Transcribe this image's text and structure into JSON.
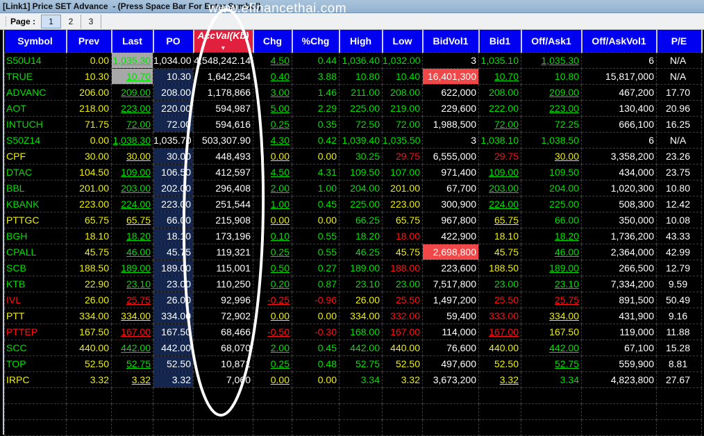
{
  "window": {
    "title": "[Link1] Price SET Advance  - (Press Space Bar For Enter Symbol)"
  },
  "watermark": "www.efinancethai.com",
  "toolbar": {
    "page_label": "Page :",
    "pages": [
      "1",
      "2",
      "3"
    ],
    "active_page": "1"
  },
  "colors": {
    "g": "#00e000",
    "y": "#f0f000",
    "r": "#ff1010",
    "w": "#ffffff",
    "header": "#0000f0",
    "sorted_header": "#e0203c"
  },
  "headers": [
    "Symbol",
    "Prev",
    "Last",
    "PO",
    "AccVal(Kb)",
    "Chg",
    "%Chg",
    "High",
    "Low",
    "BidVol1",
    "Bid1",
    "Off/Ask1",
    "Off/AskVol1",
    "P/E"
  ],
  "sorted_column": "AccVal(Kb)",
  "rows": [
    {
      "cells": [
        "S50U14",
        "0.00",
        "1,035.30",
        "1,034.00",
        "4,548,242.14",
        "4.50",
        "0.44",
        "1,036.40",
        "1,032.00",
        "3",
        "1,035.10",
        "1,035.30",
        "6",
        "N/A"
      ],
      "colors": [
        "g",
        "y",
        "g_",
        "w",
        "w",
        "g_",
        "g",
        "g",
        "g",
        "w",
        "g",
        "g_",
        "w",
        "w"
      ],
      "bg": {
        "2": "grey"
      }
    },
    {
      "cells": [
        "TRUE",
        "10.30",
        "10.70",
        "10.30",
        "1,642,254",
        "0.40",
        "3.88",
        "10.80",
        "10.40",
        "16,401,300",
        "10.70",
        "10.80",
        "15,817,000",
        "N/A"
      ],
      "colors": [
        "g",
        "y",
        "g_",
        "w",
        "w",
        "g_",
        "g",
        "g",
        "g",
        "w",
        "g_",
        "g",
        "w",
        "w"
      ],
      "bg": {
        "2": "grey",
        "3": "blue",
        "9": "red"
      }
    },
    {
      "cells": [
        "ADVANC",
        "206.00",
        "209.00",
        "208.00",
        "1,178,866",
        "3.00",
        "1.46",
        "211.00",
        "208.00",
        "622,000",
        "208.00",
        "209.00",
        "467,200",
        "17.70"
      ],
      "colors": [
        "g",
        "y",
        "g_",
        "w",
        "w",
        "g_",
        "g",
        "g",
        "g",
        "w",
        "g",
        "g_",
        "w",
        "w"
      ],
      "bg": {
        "3": "blue"
      }
    },
    {
      "cells": [
        "AOT",
        "218.00",
        "223.00",
        "220.00",
        "594,987",
        "5.00",
        "2.29",
        "225.00",
        "219.00",
        "229,600",
        "222.00",
        "223.00",
        "130,400",
        "20.96"
      ],
      "colors": [
        "g",
        "y",
        "g_",
        "w",
        "w",
        "g_",
        "g",
        "g",
        "g",
        "w",
        "g",
        "g_",
        "w",
        "w"
      ],
      "bg": {
        "3": "blue"
      }
    },
    {
      "cells": [
        "INTUCH",
        "71.75",
        "72.00",
        "72.00",
        "594,616",
        "0.25",
        "0.35",
        "72.50",
        "72.00",
        "1,988,500",
        "72.00",
        "72.25",
        "666,100",
        "16.25"
      ],
      "colors": [
        "g",
        "y",
        "g_",
        "w",
        "w",
        "g_",
        "g",
        "g",
        "g",
        "w",
        "g_",
        "g",
        "w",
        "w"
      ],
      "bg": {
        "3": "blue"
      }
    },
    {
      "cells": [
        "S50Z14",
        "0.00",
        "1,038.30",
        "1,035.70",
        "503,307.90",
        "4.30",
        "0.42",
        "1,039.40",
        "1,035.50",
        "3",
        "1,038.10",
        "1,038.50",
        "6",
        "N/A"
      ],
      "colors": [
        "g",
        "y",
        "g_",
        "w",
        "w",
        "g_",
        "g",
        "g",
        "g",
        "w",
        "g",
        "g",
        "w",
        "w"
      ],
      "bg": {}
    },
    {
      "cells": [
        "CPF",
        "30.00",
        "30.00",
        "30.00",
        "448,493",
        "0.00",
        "0.00",
        "30.25",
        "29.75",
        "6,555,000",
        "29.75",
        "30.00",
        "3,358,200",
        "23.26"
      ],
      "colors": [
        "y",
        "y",
        "y_",
        "w",
        "w",
        "y_",
        "y",
        "g",
        "r",
        "w",
        "r",
        "y_",
        "w",
        "w"
      ],
      "bg": {
        "3": "blue"
      }
    },
    {
      "cells": [
        "DTAC",
        "104.50",
        "109.00",
        "106.50",
        "412,597",
        "4.50",
        "4.31",
        "109.50",
        "107.00",
        "971,400",
        "109.00",
        "109.50",
        "434,000",
        "23.75"
      ],
      "colors": [
        "g",
        "y",
        "g_",
        "w",
        "w",
        "g_",
        "g",
        "g",
        "g",
        "w",
        "g_",
        "g",
        "w",
        "w"
      ],
      "bg": {
        "3": "blue"
      }
    },
    {
      "cells": [
        "BBL",
        "201.00",
        "203.00",
        "202.00",
        "296,408",
        "2.00",
        "1.00",
        "204.00",
        "201.00",
        "67,700",
        "203.00",
        "204.00",
        "1,020,300",
        "10.80"
      ],
      "colors": [
        "g",
        "y",
        "g_",
        "w",
        "w",
        "g_",
        "g",
        "g",
        "y",
        "w",
        "g_",
        "g",
        "w",
        "w"
      ],
      "bg": {
        "3": "blue"
      }
    },
    {
      "cells": [
        "KBANK",
        "223.00",
        "224.00",
        "223.00",
        "251,544",
        "1.00",
        "0.45",
        "225.00",
        "223.00",
        "300,900",
        "224.00",
        "225.00",
        "508,300",
        "12.42"
      ],
      "colors": [
        "g",
        "y",
        "g_",
        "w",
        "w",
        "g_",
        "g",
        "g",
        "y",
        "w",
        "g_",
        "g",
        "w",
        "w"
      ],
      "bg": {
        "3": "blue"
      }
    },
    {
      "cells": [
        "PTTGC",
        "65.75",
        "65.75",
        "66.00",
        "215,908",
        "0.00",
        "0.00",
        "66.25",
        "65.75",
        "967,800",
        "65.75",
        "66.00",
        "350,000",
        "10.08"
      ],
      "colors": [
        "y",
        "y",
        "y_",
        "w",
        "w",
        "y_",
        "y",
        "g",
        "y",
        "w",
        "y_",
        "g",
        "w",
        "w"
      ],
      "bg": {
        "3": "blue"
      }
    },
    {
      "cells": [
        "BGH",
        "18.10",
        "18.20",
        "18.10",
        "173,196",
        "0.10",
        "0.55",
        "18.20",
        "18.00",
        "422,900",
        "18.10",
        "18.20",
        "1,736,200",
        "43.33"
      ],
      "colors": [
        "g",
        "y",
        "g_",
        "w",
        "w",
        "g_",
        "g",
        "g",
        "r",
        "w",
        "y",
        "g_",
        "w",
        "w"
      ],
      "bg": {
        "3": "blue"
      }
    },
    {
      "cells": [
        "CPALL",
        "45.75",
        "46.00",
        "45.75",
        "119,321",
        "0.25",
        "0.55",
        "46.25",
        "45.75",
        "2,698,800",
        "45.75",
        "46.00",
        "2,364,000",
        "42.99"
      ],
      "colors": [
        "g",
        "y",
        "g_",
        "w",
        "w",
        "g_",
        "g",
        "g",
        "y",
        "w",
        "y",
        "g_",
        "w",
        "w"
      ],
      "bg": {
        "3": "blue",
        "9": "red"
      }
    },
    {
      "cells": [
        "SCB",
        "188.50",
        "189.00",
        "189.00",
        "115,001",
        "0.50",
        "0.27",
        "189.00",
        "188.00",
        "223,600",
        "188.50",
        "189.00",
        "266,500",
        "12.79"
      ],
      "colors": [
        "g",
        "y",
        "g_",
        "w",
        "w",
        "g_",
        "g",
        "g",
        "r",
        "w",
        "y",
        "g_",
        "w",
        "w"
      ],
      "bg": {
        "3": "blue"
      }
    },
    {
      "cells": [
        "KTB",
        "22.90",
        "23.10",
        "23.00",
        "110,250",
        "0.20",
        "0.87",
        "23.10",
        "23.00",
        "7,517,800",
        "23.00",
        "23.10",
        "7,334,200",
        "9.59"
      ],
      "colors": [
        "g",
        "y",
        "g_",
        "w",
        "w",
        "g_",
        "g",
        "g",
        "g",
        "w",
        "g",
        "g_",
        "w",
        "w"
      ],
      "bg": {
        "3": "blue"
      }
    },
    {
      "cells": [
        "IVL",
        "26.00",
        "25.75",
        "26.00",
        "92,996",
        "-0.25",
        "-0.96",
        "26.00",
        "25.50",
        "1,497,200",
        "25.50",
        "25.75",
        "891,500",
        "50.49"
      ],
      "colors": [
        "r",
        "y",
        "r_",
        "w",
        "w",
        "r_",
        "r",
        "y",
        "r",
        "w",
        "r",
        "r_",
        "w",
        "w"
      ],
      "bg": {
        "3": "blue"
      }
    },
    {
      "cells": [
        "PTT",
        "334.00",
        "334.00",
        "334.00",
        "72,902",
        "0.00",
        "0.00",
        "334.00",
        "332.00",
        "59,400",
        "333.00",
        "334.00",
        "431,900",
        "9.16"
      ],
      "colors": [
        "y",
        "y",
        "y_",
        "w",
        "w",
        "y_",
        "y",
        "y",
        "r",
        "w",
        "r",
        "y_",
        "w",
        "w"
      ],
      "bg": {
        "3": "blue"
      }
    },
    {
      "cells": [
        "PTTEP",
        "167.50",
        "167.00",
        "167.50",
        "68,466",
        "-0.50",
        "-0.30",
        "168.00",
        "167.00",
        "114,000",
        "167.00",
        "167.50",
        "119,000",
        "11.88"
      ],
      "colors": [
        "r",
        "y",
        "r_",
        "w",
        "w",
        "r_",
        "r",
        "g",
        "r",
        "w",
        "r_",
        "y",
        "w",
        "w"
      ],
      "bg": {
        "3": "blue"
      }
    },
    {
      "cells": [
        "SCC",
        "440.00",
        "442.00",
        "442.00",
        "68,070",
        "2.00",
        "0.45",
        "442.00",
        "440.00",
        "76,600",
        "440.00",
        "442.00",
        "67,100",
        "15.28"
      ],
      "colors": [
        "g",
        "y",
        "g_",
        "w",
        "w",
        "g_",
        "g",
        "g",
        "y",
        "w",
        "y",
        "g_",
        "w",
        "w"
      ],
      "bg": {
        "3": "blue"
      }
    },
    {
      "cells": [
        "TOP",
        "52.50",
        "52.75",
        "52.50",
        "10,871",
        "0.25",
        "0.48",
        "52.75",
        "52.50",
        "497,600",
        "52.50",
        "52.75",
        "559,900",
        "8.81"
      ],
      "colors": [
        "g",
        "y",
        "g_",
        "w",
        "w",
        "g_",
        "g",
        "g",
        "y",
        "w",
        "y",
        "g_",
        "w",
        "w"
      ],
      "bg": {
        "3": "blue"
      }
    },
    {
      "cells": [
        "IRPC",
        "3.32",
        "3.32",
        "3.32",
        "7,060",
        "0.00",
        "0.00",
        "3.34",
        "3.32",
        "3,673,200",
        "3.32",
        "3.34",
        "4,823,800",
        "27.67"
      ],
      "colors": [
        "y",
        "y",
        "y_",
        "w",
        "w",
        "y_",
        "y",
        "g",
        "y",
        "w",
        "y_",
        "g",
        "w",
        "w"
      ],
      "bg": {
        "3": "blue"
      }
    }
  ]
}
